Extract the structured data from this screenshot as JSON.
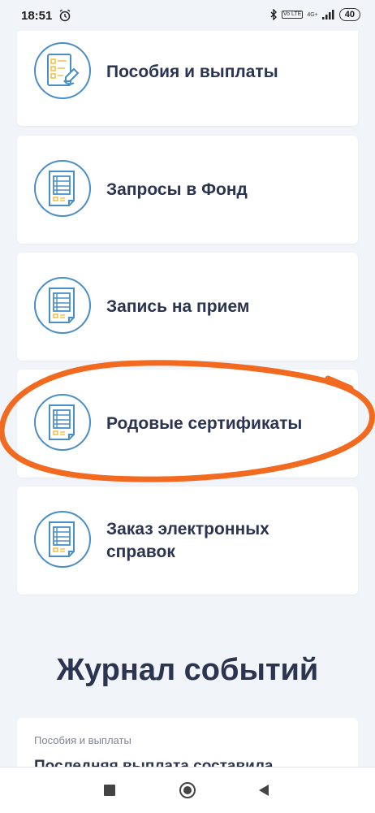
{
  "status": {
    "time": "18:51",
    "volte": "Vo LTE",
    "network": "4G+",
    "battery": "40"
  },
  "services": [
    {
      "label": "Пособия и выплаты",
      "icon": "checklist-pen-icon"
    },
    {
      "label": "Запросы в Фонд",
      "icon": "document-icon"
    },
    {
      "label": "Запись на прием",
      "icon": "document-icon"
    },
    {
      "label": "Родовые сертификаты",
      "icon": "document-icon"
    },
    {
      "label": "Заказ электронных справок",
      "icon": "document-icon"
    }
  ],
  "events": {
    "title": "Журнал событий",
    "items": [
      {
        "category": "Пособия и выплаты",
        "text": "Последняя выплата составила"
      }
    ]
  },
  "colors": {
    "icon_ring": "#4a8ec6",
    "icon_accent": "#f3c24a",
    "highlight": "#f26a1f",
    "background": "#f1f4f9"
  }
}
